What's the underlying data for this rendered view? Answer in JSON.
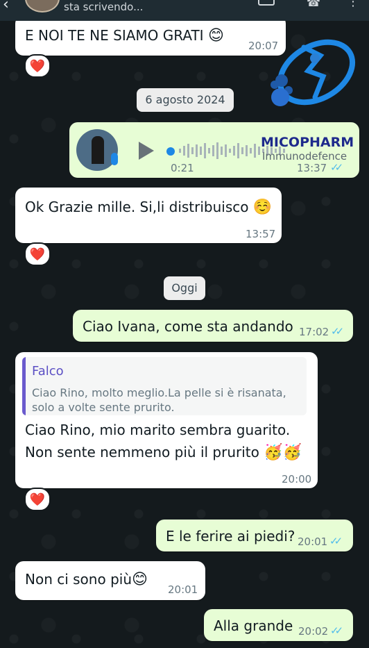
{
  "header": {
    "back": "‹",
    "status": "sta scrivendo..."
  },
  "dates": {
    "first": "6 agosto 2024",
    "second": "Oggi"
  },
  "messages": [
    {
      "text": "E NOI TE NE SIAMO GRATI",
      "emoji": "😊",
      "time": "20:07",
      "reaction": "❤️"
    },
    {
      "duration": "0:21",
      "time": "13:37",
      "ticks": "✓✓"
    },
    {
      "text": "Ok Grazie mille. Si,li distribuisco",
      "emoji": "☺️",
      "time": "13:57",
      "reaction": "❤️"
    },
    {
      "text": "Ciao Ivana, come sta andando",
      "time": "17:02",
      "ticks": "✓✓"
    },
    {
      "quote_author": "Falco",
      "quote_line1": "Ciao Rino, molto meglio.La pelle si è risanata,",
      "quote_line2": "solo a volte sente prurito.",
      "line1": "Ciao Rino, mio marito sembra guarito.",
      "line2": "Non sente nemmeno più il prurito",
      "emoji": "🥳🥳",
      "time": "20:00",
      "reaction": "❤️"
    },
    {
      "text": "E le ferire ai piedi?",
      "time": "20:01",
      "ticks": "✓✓"
    },
    {
      "text": "Non ci sono più",
      "emoji": "😊",
      "time": "20:01"
    },
    {
      "text": "Alla grande",
      "time": "20:02",
      "ticks": "✓✓"
    }
  ],
  "watermark": {
    "brand": "MICOPHARM",
    "tagline": "Immunodefence"
  },
  "colors": {
    "background": "#141a1d",
    "incoming": "#ffffff",
    "outgoing": "#e7fdd5",
    "read_tick": "#53bdeb",
    "reaction": "#e8262f"
  }
}
